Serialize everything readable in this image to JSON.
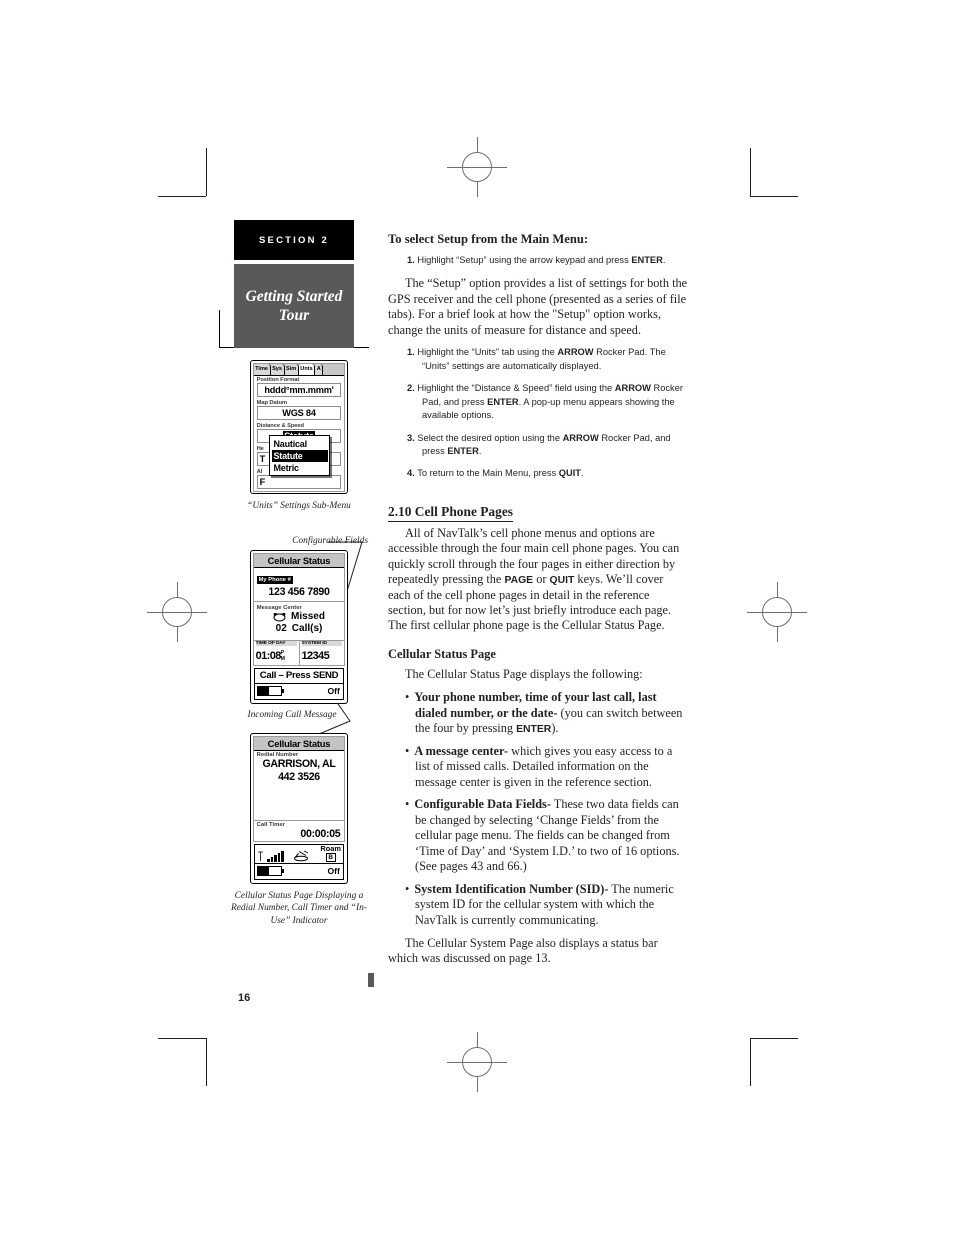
{
  "section": {
    "number": "SECTION 2",
    "title": "Getting Started\nTour"
  },
  "page_number": "16",
  "figures": {
    "units_menu": {
      "tabs": [
        "Time",
        "Sys",
        "Sim",
        "Unts",
        "A"
      ],
      "selected_tab": "Unts",
      "fields": [
        {
          "label": "Position Format",
          "value": "hddd°mm.mmm'"
        },
        {
          "label": "Map Datum",
          "value": "WGS 84"
        },
        {
          "label": "Distance & Speed",
          "value": "Statute",
          "highlighted": true
        },
        {
          "label": "He",
          "value": "T"
        },
        {
          "label": "Al",
          "value": "F"
        }
      ],
      "popup": {
        "options": [
          "Nautical",
          "Statute",
          "Metric"
        ],
        "selected": "Statute"
      },
      "caption": "“Units” Settings Sub-Menu"
    },
    "cellular_status": {
      "callout_top": "Configurable Fields",
      "title": "Cellular Status",
      "phone_label": "My Phone #",
      "phone_number": "123 456 7890",
      "message_center_label": "Message Center",
      "missed_count": "02",
      "missed_text_1": "Missed",
      "missed_text_2": "Call(s)",
      "field_left_label": "TIME OF DAY",
      "field_left_value": "01:08",
      "field_left_suffix": "PM",
      "field_right_label": "SYSTEM ID",
      "field_right_value": "12345",
      "call_prompt": "Call – Press SEND",
      "status_right": "Off",
      "caption": "Incoming Call Message"
    },
    "redial_page": {
      "title": "Cellular Status",
      "redial_label": "Redial Number",
      "redial_name": "GARRISON, AL",
      "redial_number": "442 3526",
      "call_timer_label": "Call Timer",
      "call_timer_value": "00:00:05",
      "roam_label": "Roam",
      "roam_band": "B",
      "status_right": "Off",
      "caption": "Cellular Status Page Displaying a Redial Number, Call Timer and “In-Use” Indicator"
    }
  },
  "content": {
    "heading_setup": "To select Setup from the Main Menu:",
    "step_setup": {
      "n": "1.",
      "a": "Highlight “Setup” using the arrow keypad and press ",
      "b": "ENTER",
      "c": "."
    },
    "para_setup": "The “Setup” option provides a list of settings for both the GPS receiver and the cell phone (presented as a series of file tabs). For a brief look at how the \"Setup\" option works, change the units of measure for distance and speed.",
    "steps": [
      {
        "n": "1.",
        "parts": [
          {
            "t": "Highlight the “Units” tab using the "
          },
          {
            "t": "ARROW",
            "b": true
          },
          {
            "t": " Rocker Pad. The “Units” settings are automatically displayed."
          }
        ]
      },
      {
        "n": "2.",
        "parts": [
          {
            "t": "Highlight the “Distance & Speed” field using the "
          },
          {
            "t": "ARROW",
            "b": true
          },
          {
            "t": " Rocker Pad, and press "
          },
          {
            "t": "ENTER",
            "b": true
          },
          {
            "t": ". A pop-up menu appears showing the available options."
          }
        ]
      },
      {
        "n": "3.",
        "parts": [
          {
            "t": "Select the desired option using the "
          },
          {
            "t": "ARROW",
            "b": true
          },
          {
            "t": " Rocker Pad, and press "
          },
          {
            "t": "ENTER",
            "b": true
          },
          {
            "t": "."
          }
        ]
      },
      {
        "n": "4.",
        "parts": [
          {
            "t": "To return to the Main Menu, press "
          },
          {
            "t": "QUIT",
            "b": true
          },
          {
            "t": "."
          }
        ]
      }
    ],
    "heading_cell_pages": "2.10  Cell Phone Pages",
    "para_cell_pages_1": "All of NavTalk’s cell phone menus and options are accessible through the four main cell phone pages. You can quickly scroll through the four pages in either direction by repeatedly pressing the ",
    "para_cell_pages_key1": "PAGE",
    "para_cell_pages_mid": " or ",
    "para_cell_pages_key2": "QUIT",
    "para_cell_pages_2": " keys. We’ll cover each of the cell phone pages in detail in the reference section, but for now let’s just briefly introduce each page. The first cellular phone page is the Cellular Status Page.",
    "heading_status_page": "Cellular Status Page",
    "para_status_intro": "The Cellular Status Page displays the following:",
    "bullets": [
      {
        "bold": "Your phone number, time of your last call, last dialed number, or the date-",
        "rest": " (you can switch between the four by pressing ",
        "key": "ENTER",
        "tail": ")."
      },
      {
        "bold": "A message center-",
        "rest": " which gives you easy access to a list of missed calls. Detailed information on the message center is given in the reference section."
      },
      {
        "bold": "Configurable Data Fields-",
        "rest": " These two data fields can be changed by selecting ‘Change Fields’ from the cellular page menu. The fields can be changed from ‘Time of Day’ and ‘System I.D.’ to two of 16 options. (See pages 43 and 66.)"
      },
      {
        "bold": "System Identification Number (SID)-",
        "rest": " The numeric system ID for the cellular system with which the NavTalk is currently communicating."
      }
    ],
    "para_closing": "The Cellular System Page also displays a status bar which was discussed on page 13."
  }
}
